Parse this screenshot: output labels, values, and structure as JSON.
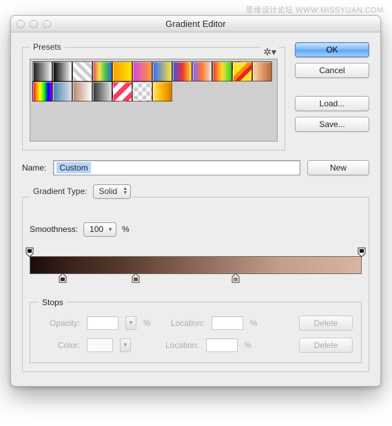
{
  "watermark": "思缘设计论坛  WWW.MISSYUAN.COM",
  "window": {
    "title": "Gradient Editor"
  },
  "presets": {
    "legend": "Presets",
    "swatches": [
      "linear-gradient(90deg,#1a1a1a,#f4f4f4)",
      "linear-gradient(90deg,#000,#fff)",
      "repeating-linear-gradient(45deg,#ccc 0 5px,#fff 5px 10px)",
      "linear-gradient(90deg,#e84546,#f6e24b,#4cc24b,#1e6de2)",
      "linear-gradient(90deg,#ff9e00,#ffe400)",
      "linear-gradient(90deg,#d644e6,#ff9b2f)",
      "linear-gradient(90deg,#2f6bff,#ffe33b)",
      "linear-gradient(90deg,#3356ff,#e93333,#ffe02f)",
      "linear-gradient(90deg,#8663ff,#ff7a2b,#e7e7e7)",
      "linear-gradient(90deg,#ff2a2a,#ffe02b,#2bd62b)",
      "linear-gradient(135deg,#ffe22b 0 40%,#ff8a00 40% 55%,#e22 55% 70%,#ffe22b 70%)",
      "linear-gradient(90deg,#ffd3a7,#b96739)",
      "linear-gradient(90deg,#ff0000,#ffa500,#ffff00,#00ff00,#0000ff,#8b00ff)",
      "linear-gradient(90deg,#477fb9,#e0e0e0)",
      "linear-gradient(90deg,#b9876b,#fff)",
      "linear-gradient(90deg,#333,#e4e4e4)",
      "repeating-linear-gradient(135deg,#ff3b5c 0 7px,#fff 7px 14px)",
      "repeating-conic-gradient(#ccc 0 25%,#fff 0 50%) 50%/12px 12px",
      "linear-gradient(90deg,#ffe76a,#ffb400,#d67b00)"
    ]
  },
  "buttons": {
    "ok": "OK",
    "cancel": "Cancel",
    "load": "Load...",
    "save": "Save...",
    "new": "New",
    "delete": "Delete"
  },
  "nameRow": {
    "label": "Name:",
    "value": "Custom"
  },
  "gradientType": {
    "legend": "Gradient Type:",
    "value": "Solid",
    "smoothnessLabel": "Smoothness:",
    "smoothnessValue": "100",
    "percent": "%",
    "gradientCss": "linear-gradient(90deg,#1a0c08 0%,#3a231a 12%,#53372a 26%,#7a5648 42%,#a17c6c 60%,#c39c8a 75%,#d9b4a1 100%)",
    "opacityStops": [
      0,
      100
    ],
    "colorStops": [
      {
        "pos": 10,
        "color": "#3a231a"
      },
      {
        "pos": 32,
        "color": "#6b4b3c"
      },
      {
        "pos": 62,
        "color": "#a5806e"
      }
    ]
  },
  "stops": {
    "legend": "Stops",
    "opacityLabel": "Opacity:",
    "colorLabel": "Color:",
    "locationLabel": "Location:",
    "percent": "%"
  }
}
